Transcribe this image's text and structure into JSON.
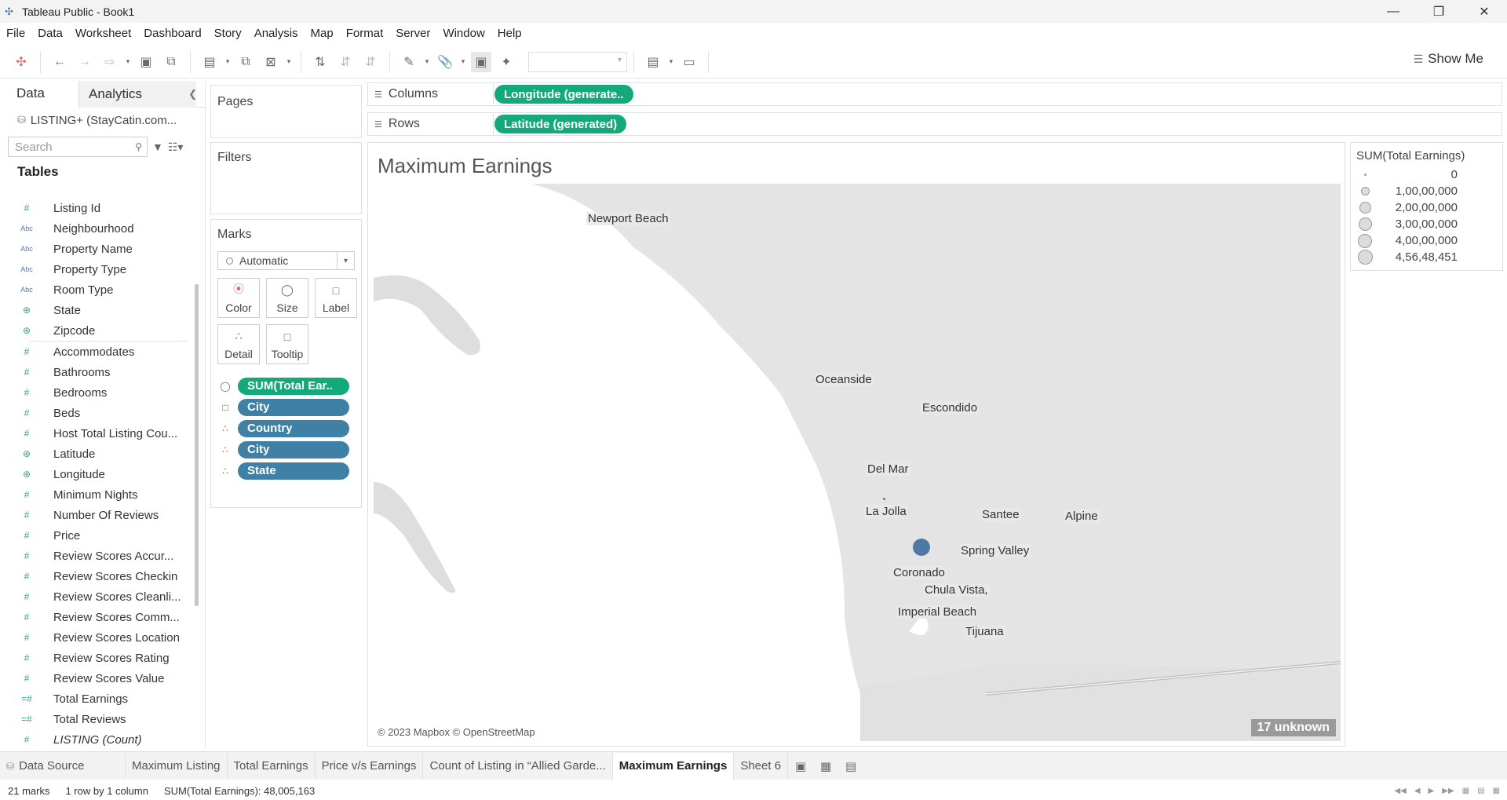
{
  "window": {
    "title": "Tableau Public - Book1"
  },
  "menu": [
    "File",
    "Data",
    "Worksheet",
    "Dashboard",
    "Story",
    "Analysis",
    "Map",
    "Format",
    "Server",
    "Window",
    "Help"
  ],
  "toolbar": {
    "show_me": "Show Me"
  },
  "data_pane": {
    "tab_data": "Data",
    "tab_analytics": "Analytics",
    "datasource": "LISTING+ (StayCatin.com...",
    "search_placeholder": "Search",
    "tables_heading": "Tables",
    "fields": [
      {
        "type": "#",
        "name": "Listing Id"
      },
      {
        "type": "Abc",
        "name": "Neighbourhood"
      },
      {
        "type": "Abc",
        "name": "Property Name"
      },
      {
        "type": "Abc",
        "name": "Property Type"
      },
      {
        "type": "Abc",
        "name": "Room Type"
      },
      {
        "type": "geo",
        "name": "State"
      },
      {
        "type": "geo",
        "name": "Zipcode"
      },
      {
        "type": "#",
        "name": "Accommodates"
      },
      {
        "type": "#",
        "name": "Bathrooms"
      },
      {
        "type": "#",
        "name": "Bedrooms"
      },
      {
        "type": "#",
        "name": "Beds"
      },
      {
        "type": "#",
        "name": "Host Total Listing Cou..."
      },
      {
        "type": "geo",
        "name": "Latitude"
      },
      {
        "type": "geo",
        "name": "Longitude"
      },
      {
        "type": "#",
        "name": "Minimum Nights"
      },
      {
        "type": "#",
        "name": "Number Of Reviews"
      },
      {
        "type": "#",
        "name": "Price"
      },
      {
        "type": "#",
        "name": "Review Scores Accur..."
      },
      {
        "type": "#",
        "name": "Review Scores Checkin"
      },
      {
        "type": "#",
        "name": "Review Scores Cleanli..."
      },
      {
        "type": "#",
        "name": "Review Scores Comm..."
      },
      {
        "type": "#",
        "name": "Review Scores Location"
      },
      {
        "type": "#",
        "name": "Review Scores Rating"
      },
      {
        "type": "#",
        "name": "Review Scores Value"
      },
      {
        "type": "=#",
        "name": "Total Earnings"
      },
      {
        "type": "=#",
        "name": "Total Reviews"
      },
      {
        "type": "#",
        "name": "LISTING (Count)"
      }
    ]
  },
  "cards": {
    "pages": "Pages",
    "filters": "Filters",
    "marks": "Marks",
    "mark_type": "Automatic",
    "mark_buttons": [
      "Color",
      "Size",
      "Label",
      "Detail",
      "Tooltip"
    ],
    "mark_fields": [
      {
        "role": "size",
        "label": "SUM(Total Ear.."
      },
      {
        "role": "label",
        "label": "City"
      },
      {
        "role": "detail",
        "label": "Country"
      },
      {
        "role": "detail",
        "label": "City"
      },
      {
        "role": "detail",
        "label": "State"
      }
    ]
  },
  "shelves": {
    "columns_label": "Columns",
    "columns_pill": "Longitude (generate..",
    "rows_label": "Rows",
    "rows_pill": "Latitude (generated)"
  },
  "viz": {
    "title": "Maximum Earnings",
    "map_labels": [
      "Newport Beach",
      "Oceanside",
      "Escondido",
      "Del Mar",
      "La Jolla",
      "Santee",
      "Alpine",
      "Spring Valley",
      "Coronado",
      "Chula Vista,",
      "Imperial Beach",
      "Tijuana"
    ],
    "copyright": "© 2023 Mapbox © OpenStreetMap",
    "unknown_badge": "17 unknown",
    "accent_point_color": "#4e79a7"
  },
  "legend": {
    "title": "SUM(Total Earnings)",
    "items": [
      "0",
      "1,00,00,000",
      "2,00,00,000",
      "3,00,00,000",
      "4,00,00,000",
      "4,56,48,451"
    ]
  },
  "sheet_tabs": {
    "data_source": "Data Source",
    "sheets": [
      "Maximum Listing",
      "Total Earnings",
      "Price v/s Earnings",
      "Count of Listing in “Allied Garde...",
      "Maximum Earnings",
      "Sheet 6"
    ],
    "active": "Maximum Earnings"
  },
  "status": {
    "marks": "21 marks",
    "dims": "1 row by 1 column",
    "sum": "SUM(Total Earnings): 48,005,163"
  }
}
